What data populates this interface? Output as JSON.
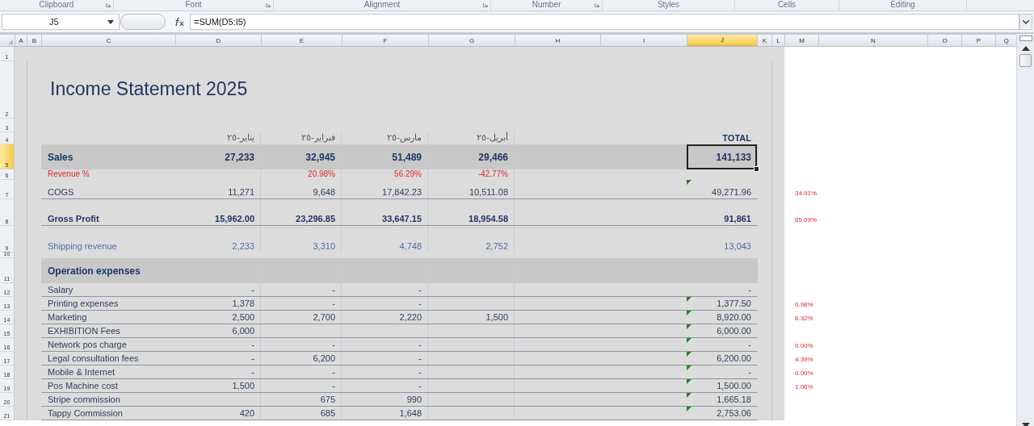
{
  "ribbon_groups": [
    {
      "label": "Clipboard",
      "launcher": true
    },
    {
      "label": "Font",
      "launcher": true
    },
    {
      "label": "Alignment",
      "launcher": true
    },
    {
      "label": "Number",
      "launcher": true
    },
    {
      "label": "Styles",
      "launcher": false
    },
    {
      "label": "Cells",
      "launcher": false
    },
    {
      "label": "Editing",
      "launcher": false
    }
  ],
  "formula_bar": {
    "name_box": "J5",
    "formula": "=SUM(D5:I5)"
  },
  "columns": [
    {
      "label": "A",
      "selected": false
    },
    {
      "label": "B",
      "selected": false
    },
    {
      "label": "C",
      "selected": false
    },
    {
      "label": "D",
      "selected": false
    },
    {
      "label": "E",
      "selected": false
    },
    {
      "label": "F",
      "selected": false
    },
    {
      "label": "G",
      "selected": false
    },
    {
      "label": "H",
      "selected": false
    },
    {
      "label": "I",
      "selected": false
    },
    {
      "label": "J",
      "selected": true
    },
    {
      "label": "K",
      "selected": false
    },
    {
      "label": "L",
      "selected": false
    },
    {
      "label": "M",
      "selected": false
    },
    {
      "label": "N",
      "selected": false
    },
    {
      "label": "O",
      "selected": false
    },
    {
      "label": "P",
      "selected": false
    },
    {
      "label": "Q",
      "selected": false
    }
  ],
  "rows": [
    {
      "number": "1",
      "selected": false,
      "kind": "blank"
    },
    {
      "number": "2",
      "selected": false,
      "kind": "title",
      "cells": {
        "C": "Income Statement 2025"
      }
    },
    {
      "number": "3",
      "selected": false,
      "kind": "blank"
    },
    {
      "number": "4",
      "selected": false,
      "kind": "header",
      "cells": {
        "D": "يناير-٢٥",
        "E": "فبراير-٢٥",
        "F": "مارس-٢٥",
        "G": "أبريل-٢٥",
        "J": "TOTAL"
      }
    },
    {
      "number": "5",
      "selected": true,
      "kind": "band",
      "cells": {
        "C": "Sales",
        "D": "27,233",
        "E": "32,945",
        "F": "51,489",
        "G": "29,466",
        "J": "141,133"
      }
    },
    {
      "number": "6",
      "selected": false,
      "kind": "percent",
      "cells": {
        "C": "Revenue %",
        "E": "20.98%",
        "F": "56.29%",
        "G": "-42.77%"
      }
    },
    {
      "number": "7",
      "selected": false,
      "kind": "line",
      "flagged": true,
      "cells": {
        "C": "COGS",
        "D": "11,271",
        "E": "9,648",
        "F": "17,842.23",
        "G": "10,511.08",
        "J": "49,271.96",
        "M": "34.91%"
      }
    },
    {
      "number": "8",
      "selected": false,
      "kind": "bold",
      "cells": {
        "C": "Gross Profit",
        "D": "15,962.00",
        "E": "23,296.85",
        "F": "33,647.15",
        "G": "18,954.58",
        "J": "91,861",
        "M": "65.09%"
      }
    },
    {
      "number": "9",
      "selected": false,
      "kind": "blue",
      "cells": {
        "C": "Shipping revenue",
        "D": "2,233",
        "E": "3,310",
        "F": "4,748",
        "G": "2,752",
        "J": "13,043"
      }
    },
    {
      "number": "10",
      "selected": false,
      "kind": "spacer"
    },
    {
      "number": "11",
      "selected": false,
      "kind": "section",
      "cells": {
        "C": "Operation expenses"
      }
    },
    {
      "number": "12",
      "selected": false,
      "kind": "expense",
      "cells": {
        "C": "Salary",
        "D": "-",
        "E": "-",
        "F": "-",
        "J": "-"
      }
    },
    {
      "number": "13",
      "selected": false,
      "kind": "expense",
      "flagged": true,
      "cells": {
        "C": "Printing expenses",
        "D": "1,378",
        "E": "-",
        "F": "-",
        "J": "1,377.50",
        "M": "0.98%"
      }
    },
    {
      "number": "14",
      "selected": false,
      "kind": "expense",
      "flagged": true,
      "cells": {
        "C": "Marketing",
        "D": "2,500",
        "E": "2,700",
        "F": "2,220",
        "G": "1,500",
        "J": "8,920.00",
        "M": "6.32%"
      }
    },
    {
      "number": "15",
      "selected": false,
      "kind": "expense",
      "flagged": true,
      "cells": {
        "C": "EXHIBITION Fees",
        "D": "6,000",
        "J": "6,000.00"
      }
    },
    {
      "number": "16",
      "selected": false,
      "kind": "expense",
      "flagged": true,
      "cells": {
        "C": "Network pos charge",
        "D": "-",
        "E": "-",
        "F": "-",
        "J": "-",
        "M": "0.00%"
      }
    },
    {
      "number": "17",
      "selected": false,
      "kind": "expense",
      "flagged": true,
      "cells": {
        "C": "Legal consultation fees",
        "D": "-",
        "E": "6,200",
        "F": "-",
        "J": "6,200.00",
        "M": "4.39%"
      }
    },
    {
      "number": "18",
      "selected": false,
      "kind": "expense",
      "flagged": true,
      "cells": {
        "C": "Mobile & Internet",
        "D": "-",
        "E": "-",
        "F": "-",
        "J": "-",
        "M": "0.00%"
      }
    },
    {
      "number": "19",
      "selected": false,
      "kind": "expense",
      "flagged": true,
      "cells": {
        "C": "Pos Machine cost",
        "D": "1,500",
        "E": "-",
        "F": "-",
        "J": "1,500.00",
        "M": "1.06%"
      }
    },
    {
      "number": "20",
      "selected": false,
      "kind": "expense",
      "flagged": true,
      "cells": {
        "C": "Stripe commission",
        "E": "675",
        "F": "990",
        "J": "1,665.18"
      }
    },
    {
      "number": "21",
      "selected": false,
      "kind": "expense",
      "flagged": true,
      "cells": {
        "C": "Tappy Commission",
        "D": "420",
        "E": "685",
        "F": "1,648",
        "J": "2,753.06"
      }
    }
  ]
}
